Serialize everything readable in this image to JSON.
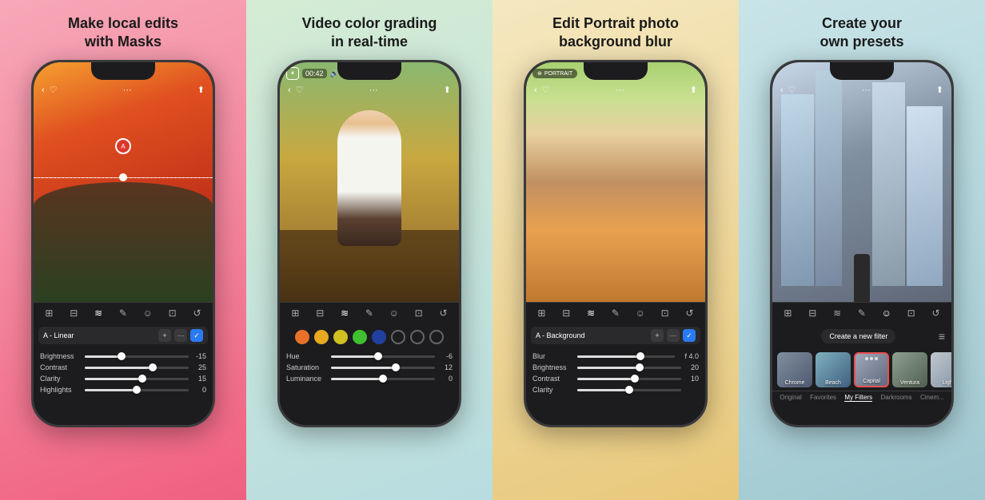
{
  "panels": [
    {
      "id": "panel-1",
      "title": "Make local edits\nwith Masks",
      "bg": "panel-1",
      "phone": {
        "preset_label": "A - Linear",
        "controls": [
          {
            "label": "Brightness",
            "value": "-15",
            "fill_pct": 35
          },
          {
            "label": "Contrast",
            "value": "25",
            "fill_pct": 65
          },
          {
            "label": "Clarity",
            "value": "15",
            "fill_pct": 55
          },
          {
            "label": "Highlights",
            "value": "0",
            "fill_pct": 50
          }
        ]
      }
    },
    {
      "id": "panel-2",
      "title": "Video color grading\nin real-time",
      "bg": "panel-2",
      "phone": {
        "video_time": "00:42",
        "hue_value": "-6",
        "saturation_value": "12",
        "luminance_value": "0",
        "controls": [
          {
            "label": "Hue",
            "value": "-6",
            "fill_pct": 45
          },
          {
            "label": "Saturation",
            "value": "12",
            "fill_pct": 60
          },
          {
            "label": "Luminance",
            "value": "0",
            "fill_pct": 50
          }
        ]
      }
    },
    {
      "id": "panel-3",
      "title": "Edit Portrait photo\nbackground blur",
      "bg": "panel-3",
      "phone": {
        "preset_label": "A - Background",
        "badge_label": "PORTRAIT",
        "controls": [
          {
            "label": "Blur",
            "value": "f 4.0",
            "fill_pct": 65
          },
          {
            "label": "Brightness",
            "value": "20",
            "fill_pct": 60
          },
          {
            "label": "Contrast",
            "value": "10",
            "fill_pct": 55
          },
          {
            "label": "Clarity",
            "value": "",
            "fill_pct": 50
          }
        ]
      }
    },
    {
      "id": "panel-4",
      "title": "Create your\nown presets",
      "bg": "panel-4",
      "phone": {
        "create_btn_label": "Create a new filter",
        "presets": [
          {
            "label": "Chrome",
            "active": false
          },
          {
            "label": "Beach",
            "active": false
          },
          {
            "label": "Capital",
            "active": true
          },
          {
            "label": "Ventura",
            "active": false
          },
          {
            "label": "Light",
            "active": false
          }
        ],
        "tabs": [
          {
            "label": "Original",
            "active": false
          },
          {
            "label": "Favorites",
            "active": false
          },
          {
            "label": "My Filters",
            "active": true
          },
          {
            "label": "Darkrooms",
            "active": false
          },
          {
            "label": "Cinem...",
            "active": false
          }
        ]
      }
    }
  ],
  "toolbar_icons": [
    "⊞",
    "⊟",
    "≋",
    "✎",
    "☺",
    "⊡",
    "↺"
  ],
  "colors": {
    "orange": "#e87028",
    "yellow_orange": "#e8a020",
    "yellow": "#d8c020",
    "green": "#50c840",
    "dark_blue": "#2040a0",
    "medium_blue": "#4060c0",
    "light_blue": "#6080d0",
    "outline1": "outline",
    "outline2": "outline"
  }
}
